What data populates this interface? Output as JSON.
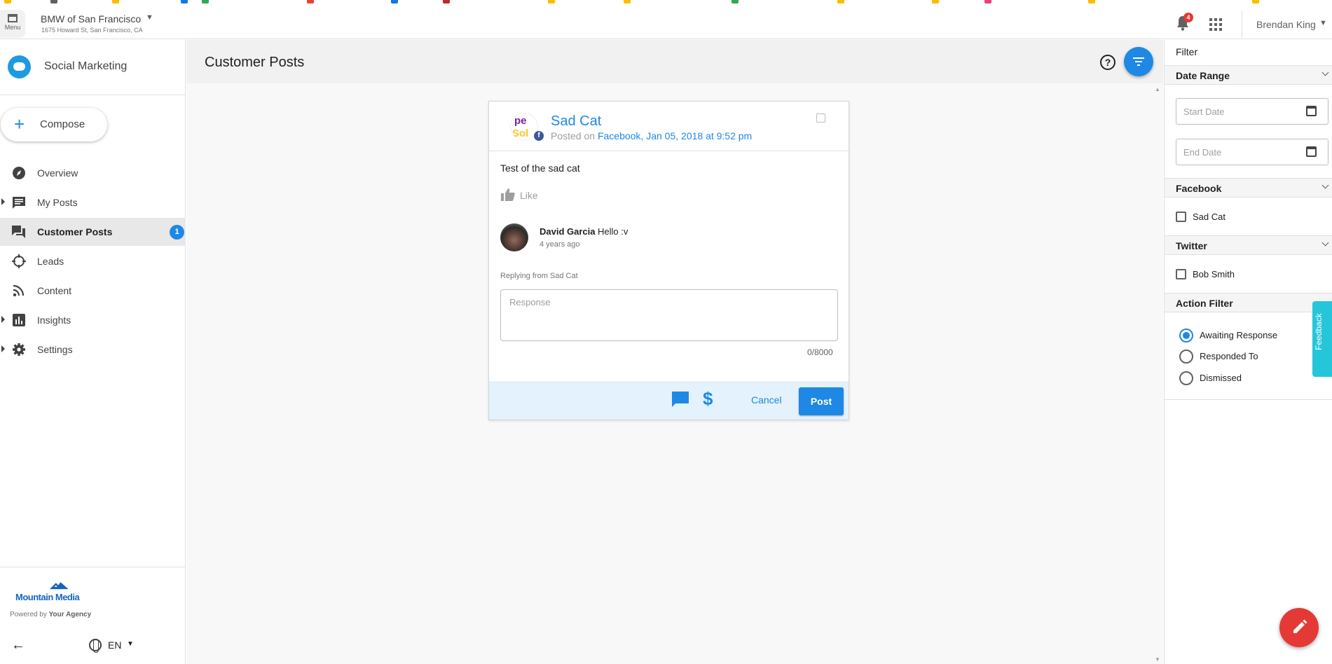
{
  "topbar": {
    "menu_label": "Menu",
    "account_name": "BMW of San Francisco",
    "account_address": "1675 Howard St, San Francisco, CA",
    "notification_count": "4",
    "user_name": "Brendan King"
  },
  "sidebar": {
    "title": "Social Marketing",
    "compose_label": "Compose",
    "items": [
      {
        "label": "Overview"
      },
      {
        "label": "My Posts"
      },
      {
        "label": "Customer Posts",
        "badge": "1"
      },
      {
        "label": "Leads"
      },
      {
        "label": "Content"
      },
      {
        "label": "Insights"
      },
      {
        "label": "Settings"
      }
    ],
    "footer": {
      "logo_text": "Mountain Media",
      "powered_prefix": "Powered by",
      "powered_by": "Your Agency",
      "language": "EN"
    }
  },
  "main": {
    "title": "Customer Posts",
    "help_label": "?"
  },
  "post": {
    "avatar_top": "pe",
    "avatar_bottom": "Sol",
    "author": "Sad Cat",
    "posted_prefix": "Posted on",
    "posted_link": "Facebook, Jan 05, 2018 at 9:52 pm",
    "body": "Test of the sad cat",
    "like_label": "Like",
    "comment": {
      "author": "David Garcia",
      "text": "Hello :v",
      "time": "4 years ago"
    },
    "replying_from": "Replying from Sad Cat",
    "response_placeholder": "Response",
    "char_counter": "0/8000",
    "cancel_label": "Cancel",
    "post_label": "Post"
  },
  "filter": {
    "title": "Filter",
    "date_range": {
      "heading": "Date Range",
      "start_placeholder": "Start Date",
      "end_placeholder": "End Date"
    },
    "facebook": {
      "heading": "Facebook",
      "options": [
        "Sad Cat"
      ]
    },
    "twitter": {
      "heading": "Twitter",
      "options": [
        "Bob Smith"
      ]
    },
    "action_filter": {
      "heading": "Action Filter",
      "options": [
        "Awaiting Response",
        "Responded To",
        "Dismissed"
      ],
      "selected": "Awaiting Response"
    },
    "feedback_label": "Feedback"
  },
  "colors": {
    "accent": "#1e88e5",
    "fab_red": "#e53935",
    "feedback": "#26c6da"
  }
}
